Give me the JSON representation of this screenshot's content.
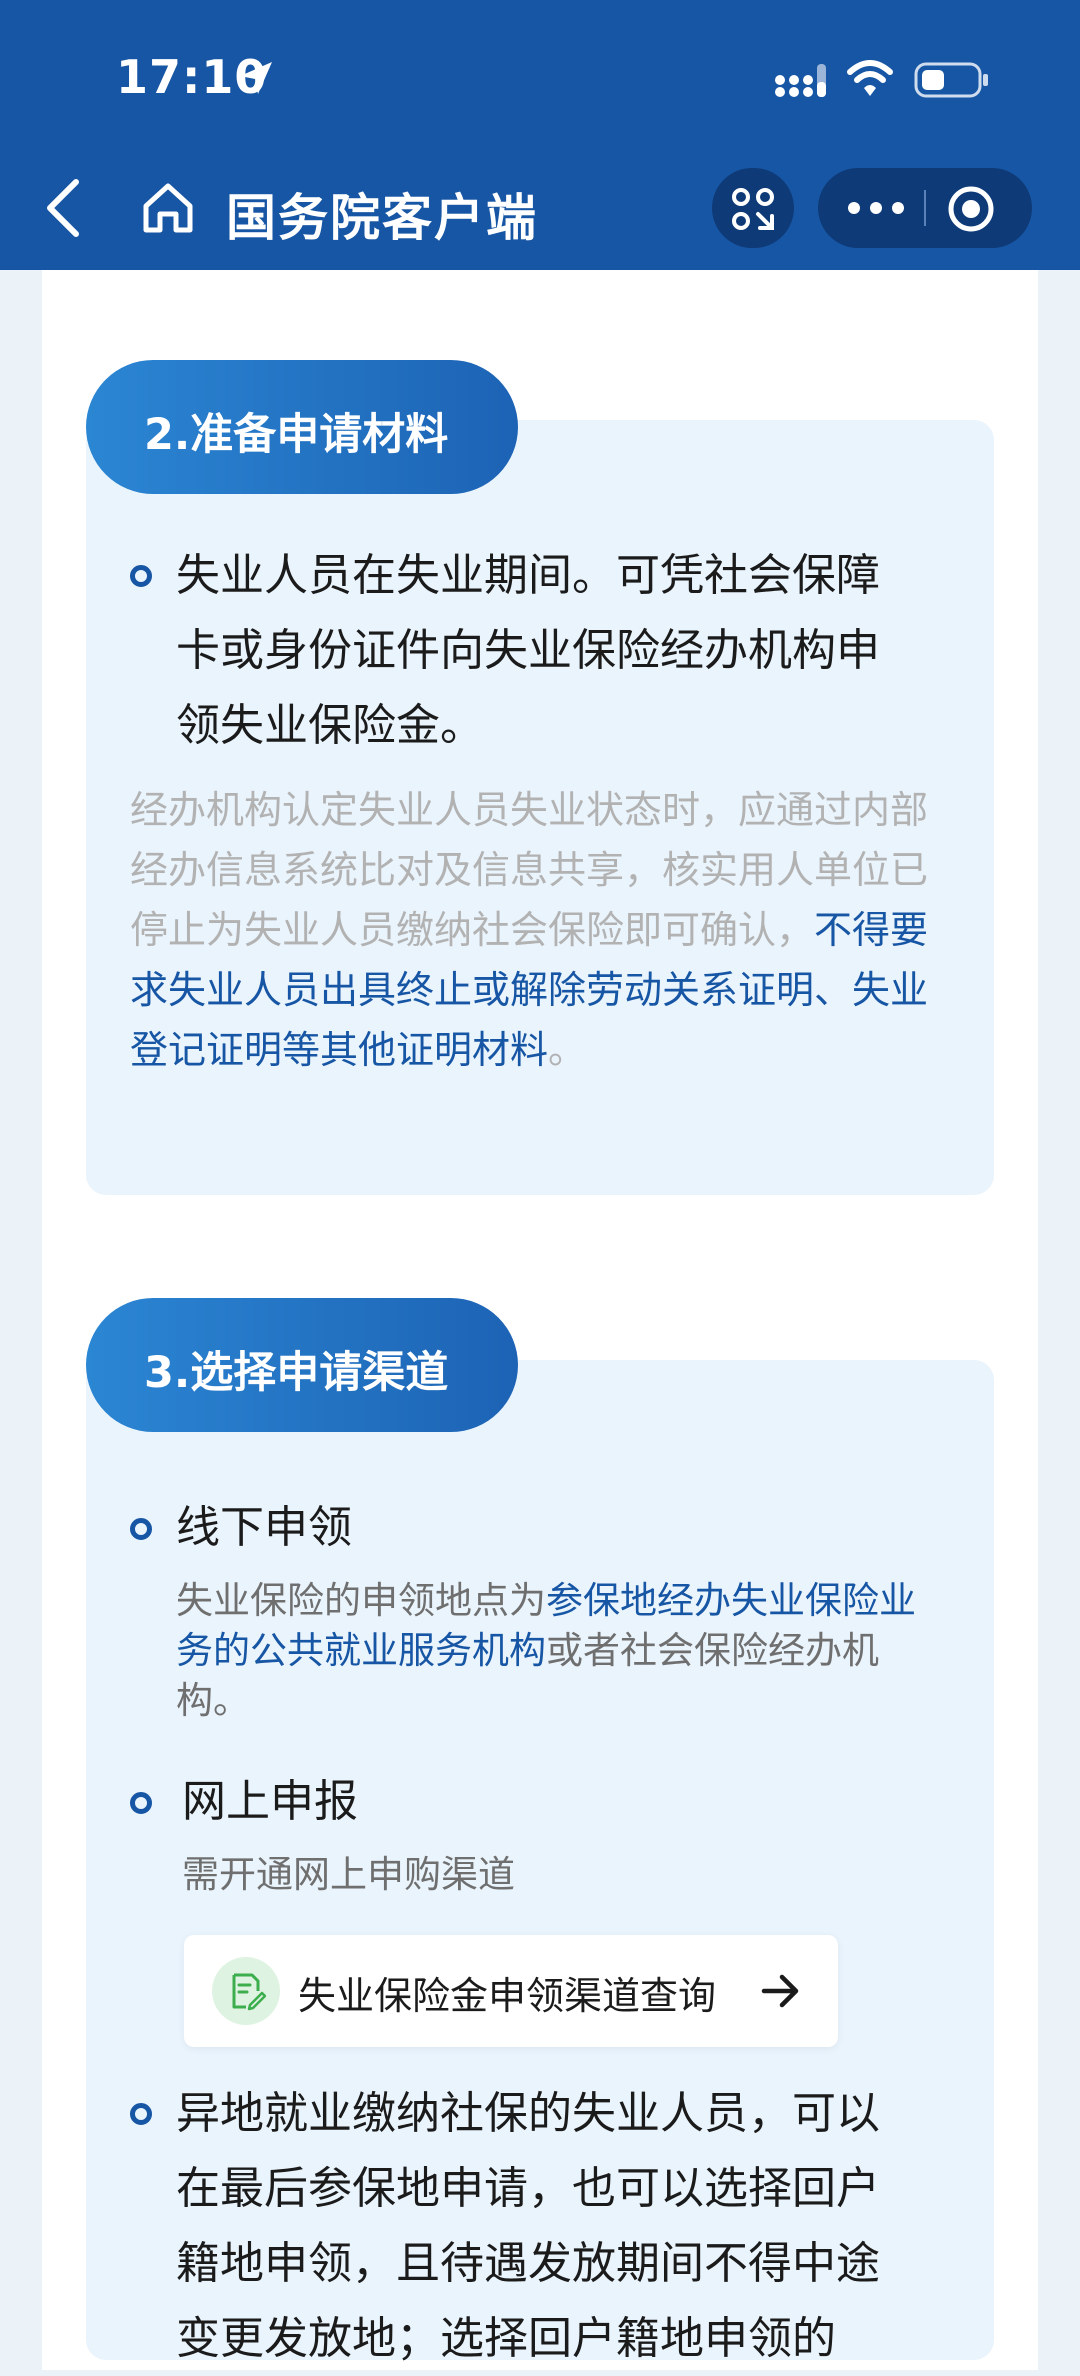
{
  "status": {
    "time": "17:10"
  },
  "nav": {
    "title": "国务院客户端"
  },
  "section2": {
    "heading": "2.准备申请材料",
    "bullet_text": "失业人员在失业期间。可凭社会保障卡或身份证件向失业保险经办机构申领失业保险金。",
    "note_plain": "经办机构认定失业人员失业状态时，应通过内部经办信息系统比对及信息共享，核实用人单位已停止为失业人员缴纳社会保险即可确认，",
    "note_highlight": "不得要求失业人员出具终止或解除劳动关系证明、失业登记证明等其他证明材料",
    "note_end": "。"
  },
  "section3": {
    "heading": "3.选择申请渠道",
    "offline": {
      "title": "线下申领",
      "desc_plain_1": "失业保险的申领地点为",
      "desc_highlight": "参保地经办失业保险业务的公共就业服务机构",
      "desc_plain_2": "或者社会保险经办机构。"
    },
    "online": {
      "title": "网上申报",
      "desc": "需开通网上申购渠道",
      "link_label": "失业保险金申领渠道查询"
    },
    "remote": {
      "text": "异地就业缴纳社保的失业人员，可以在最后参保地申请，也可以选择回户籍地申领，且待遇发放期间不得中途变更发放地；选择回户籍地申领的"
    }
  }
}
